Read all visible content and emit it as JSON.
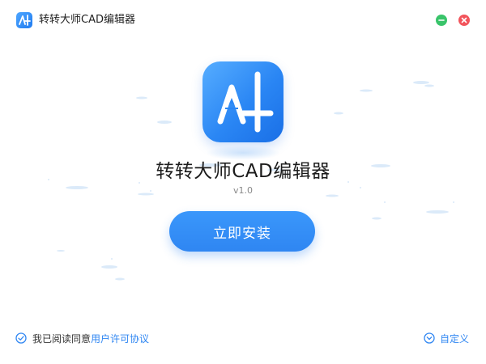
{
  "window": {
    "title": "转转大师CAD编辑器",
    "minimize_color": "#39c46a",
    "close_color": "#f2545b"
  },
  "app": {
    "icon_name": "app-logo-icon",
    "icon_letters": "A",
    "name": "转转大师CAD编辑器",
    "version": "v1.0"
  },
  "actions": {
    "install_label": "立即安装"
  },
  "footer": {
    "agree_prefix": "我已阅读同意",
    "license_link": "用户许可协议",
    "custom_label": "自定义"
  },
  "colors": {
    "accent": "#2f86f2",
    "icon_gradient_start": "#56adff",
    "icon_gradient_end": "#1a6fe6"
  }
}
